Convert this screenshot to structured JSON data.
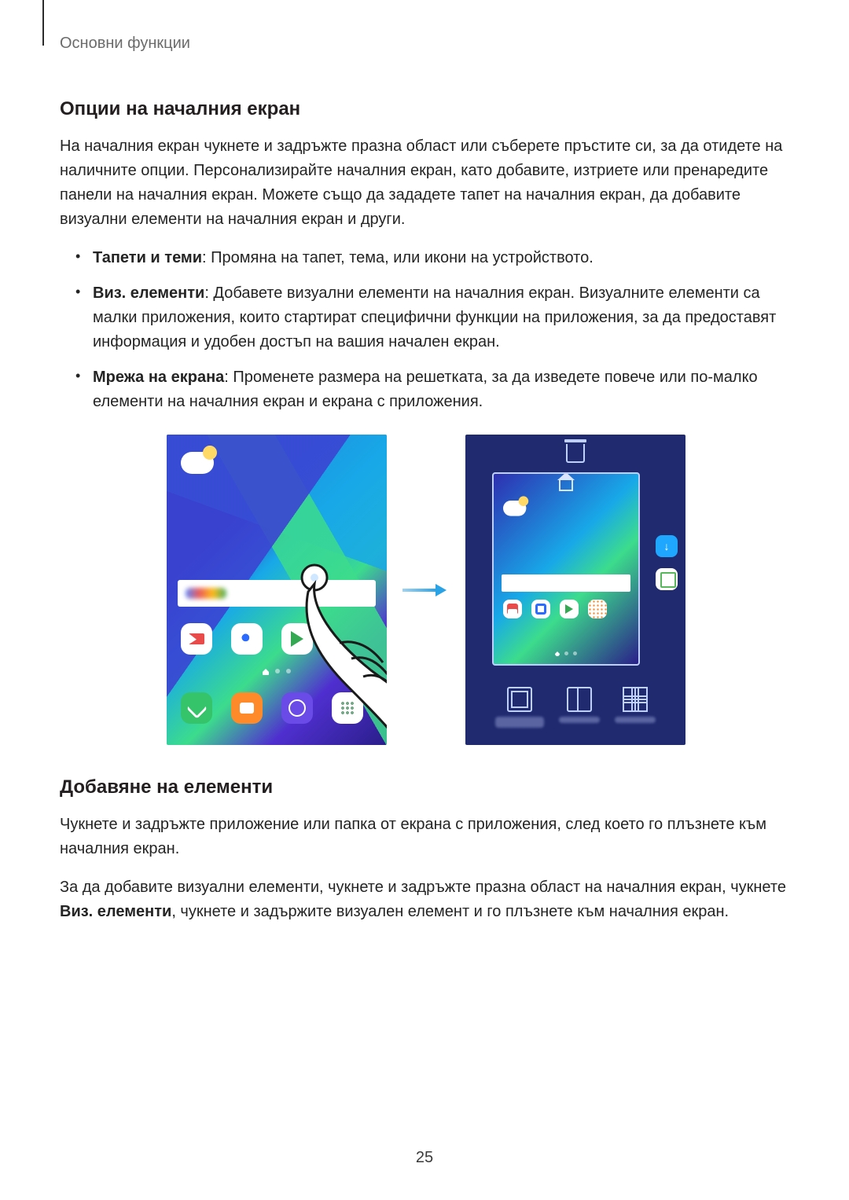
{
  "running_head": "Основни функции",
  "section1": {
    "heading": "Опции на началния екран",
    "intro": "На началния екран чукнете и задръжте празна област или съберете пръстите си, за да отидете на наличните опции. Персонализирайте началния екран, като добавите, изтриете или пренаредите панели на началния екран. Можете също да зададете тапет на началния екран, да добавите визуални елементи на началния екран и други.",
    "bullets": [
      {
        "bold": "Тапети и теми",
        "rest": ": Промяна на тапет, тема, или икони на устройството."
      },
      {
        "bold": "Виз. елементи",
        "rest": ": Добавете визуални елементи на началния екран. Визуалните елементи са малки приложения, които стартират специфични функции на приложения, за да предоставят информация и удобен достъп на вашия начален екран."
      },
      {
        "bold": "Мрежа на екрана",
        "rest": ": Променете размера на решетката, за да изведете повече или по-малко елементи на началния екран и екрана с приложения."
      }
    ]
  },
  "section2": {
    "heading": "Добавяне на елементи",
    "para1": "Чукнете и задръжте приложение или папка от екрана с приложения, след което го плъзнете към началния екран.",
    "para2_pre": "За да добавите визуални елементи, чукнете и задръжте празна област на началния екран, чукнете ",
    "para2_bold": "Виз. елементи",
    "para2_post": ", чукнете и задържите визуален елемент и го плъзнете към началния екран."
  },
  "page_number": "25"
}
